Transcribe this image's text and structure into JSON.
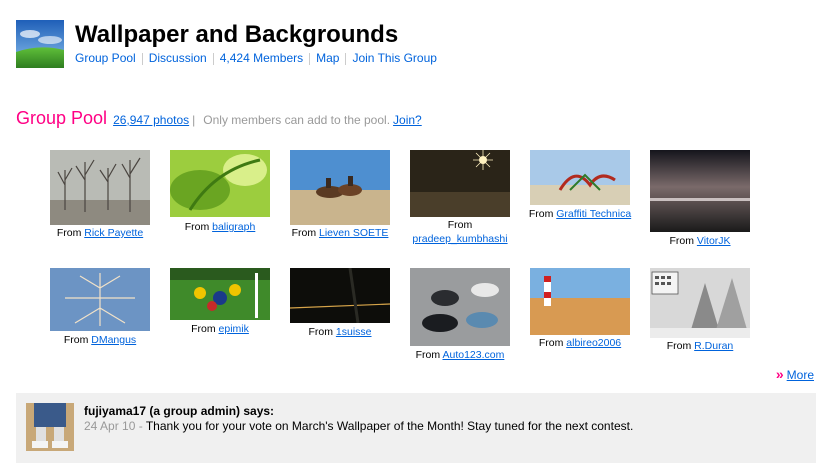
{
  "group": {
    "title": "Wallpaper and Backgrounds",
    "nav": [
      "Group Pool",
      "Discussion",
      "4,424 Members",
      "Map",
      "Join This Group"
    ]
  },
  "pool": {
    "title": "Group Pool",
    "count_link": "26,947 photos",
    "separator": "|",
    "note": "Only members can add to the pool.",
    "join_link": "Join?"
  },
  "photos": [
    {
      "from": "From",
      "author": "Rick Payette"
    },
    {
      "from": "From",
      "author": "baligraph"
    },
    {
      "from": "From",
      "author": "Lieven SOETE"
    },
    {
      "from": "From",
      "author": "pradeep_kumbhashi"
    },
    {
      "from": "From",
      "author": "Graffiti Technica"
    },
    {
      "from": "From",
      "author": "VitorJK"
    },
    {
      "from": "From",
      "author": "DMangus"
    },
    {
      "from": "From",
      "author": "epimik"
    },
    {
      "from": "From",
      "author": "1suisse"
    },
    {
      "from": "From",
      "author": "Auto123.com"
    },
    {
      "from": "From",
      "author": "albireo2006"
    },
    {
      "from": "From",
      "author": "R.Duran"
    }
  ],
  "more": {
    "arrow": "»",
    "label": "More"
  },
  "discussion": {
    "author": "fujiyama17 (a group admin) says:",
    "date": "24 Apr 10 -",
    "message": "Thank you for your vote on March's Wallpaper of the Month! Stay tuned for the next contest."
  }
}
